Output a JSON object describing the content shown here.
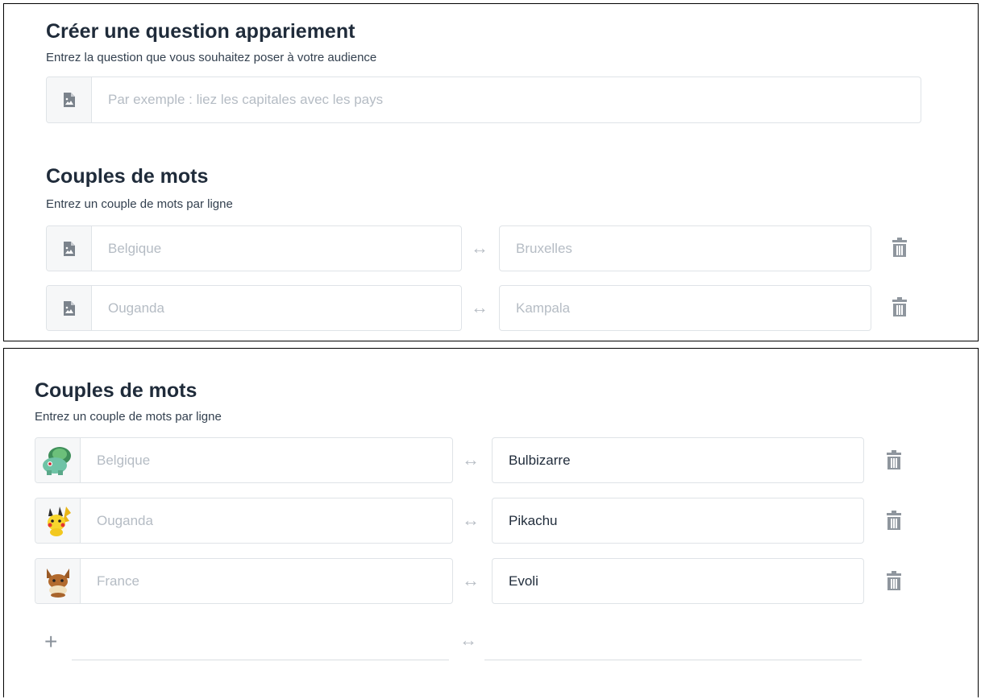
{
  "question_section": {
    "title": "Créer une question appariement",
    "subtitle": "Entrez la question que vous souhaitez poser à votre audience",
    "question_placeholder": "Par exemple : liez les capitales avec les pays"
  },
  "pairs_section_top": {
    "title": "Couples de mots",
    "subtitle": "Entrez un couple de mots par ligne",
    "rows": [
      {
        "left": "Belgique",
        "right": "Bruxelles"
      },
      {
        "left": "Ouganda",
        "right": "Kampala"
      }
    ]
  },
  "pairs_section_bottom": {
    "title": "Couples de mots",
    "subtitle": "Entrez un couple de mots par ligne",
    "rows": [
      {
        "left": "Belgique",
        "right": "Bulbizarre",
        "image": "bulbasaur-sprite"
      },
      {
        "left": "Ouganda",
        "right": "Pikachu",
        "image": "pikachu-sprite"
      },
      {
        "left": "France",
        "right": "Evoli",
        "image": "eevee-sprite"
      }
    ],
    "add_icon": "plus-icon"
  },
  "icons": {
    "image": "image-file-icon",
    "pair": "double-arrow-icon",
    "delete": "trash-icon"
  },
  "colors": {
    "text_dark": "#1f2b3a",
    "placeholder": "#b5bcc4",
    "border": "#dfe3e7",
    "icon_gray": "#7b838c"
  }
}
